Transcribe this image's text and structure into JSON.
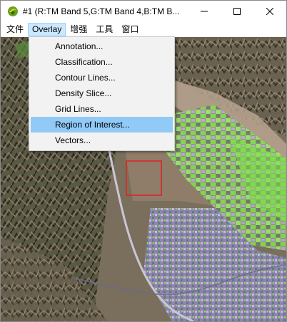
{
  "window": {
    "title": "#1 (R:TM Band 5,G:TM Band 4,B:TM B...",
    "minimize_icon": "minimize-icon",
    "maximize_icon": "maximize-icon",
    "close_icon": "close-icon"
  },
  "menubar": {
    "items": [
      {
        "label": "文件"
      },
      {
        "label": "Overlay",
        "active": true
      },
      {
        "label": "增强"
      },
      {
        "label": "工具"
      },
      {
        "label": "窗口"
      }
    ]
  },
  "overlay_menu": {
    "items": [
      {
        "label": "Annotation..."
      },
      {
        "label": "Classification..."
      },
      {
        "label": "Contour Lines..."
      },
      {
        "label": "Density Slice..."
      },
      {
        "label": "Grid Lines..."
      },
      {
        "label": "Region of Interest...",
        "highlighted": true
      },
      {
        "label": "Vectors..."
      }
    ]
  },
  "colors": {
    "menu_active_bg": "#cce8ff",
    "menu_highlight_bg": "#91c9f7",
    "roi_box": "#e02020",
    "vegetation_green": "#7ee04a",
    "urban_lavender": "#b9a9d9"
  }
}
